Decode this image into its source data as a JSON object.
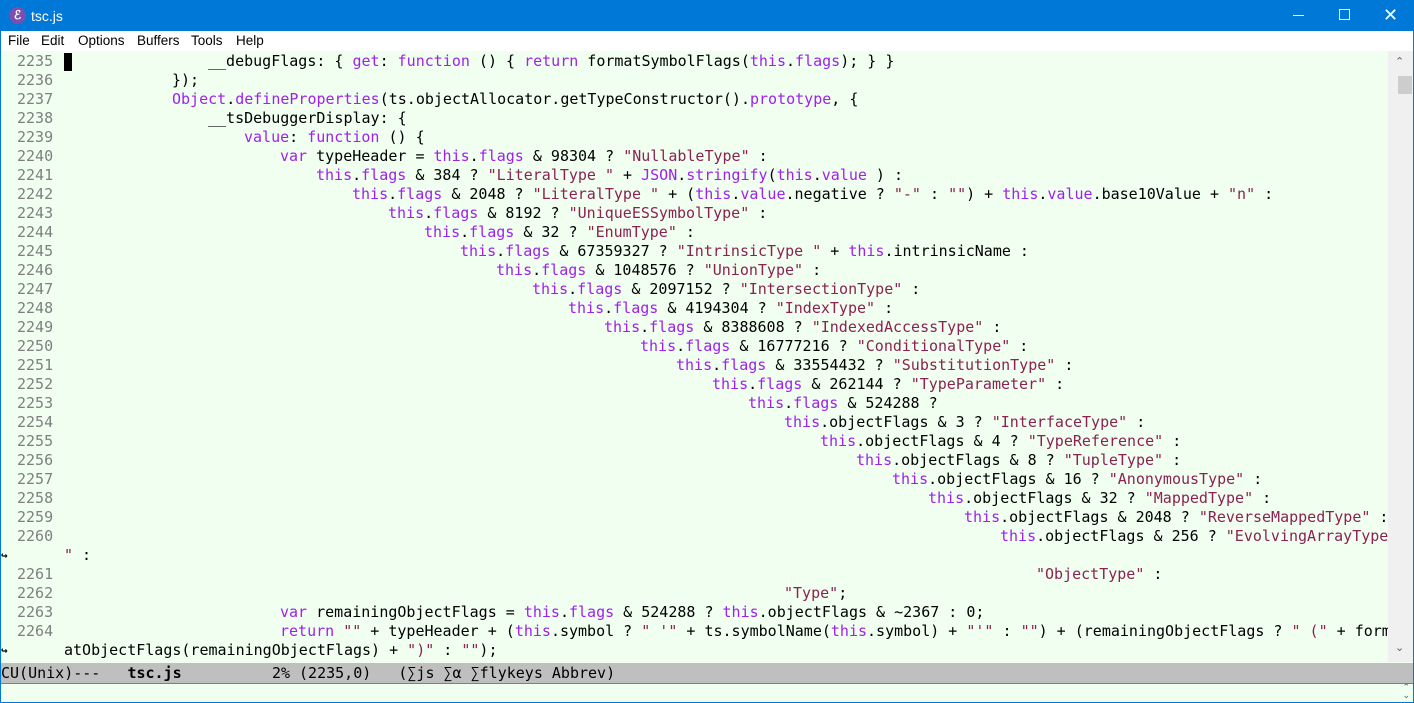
{
  "window": {
    "title": "tsc.js",
    "app_icon": "emacs-icon",
    "controls": [
      "minimize",
      "maximize",
      "close"
    ]
  },
  "menubar": {
    "items": [
      "File",
      "Edit",
      "Options",
      "Buffers",
      "Tools",
      "Help"
    ]
  },
  "editor": {
    "cursor_line": 2235,
    "lines": [
      {
        "num": "2235",
        "indent": 16,
        "tokens": [
          [
            "",
            "__debugFlags: { "
          ],
          [
            "kw",
            "get"
          ],
          [
            "",
            ": "
          ],
          [
            "kw",
            "function"
          ],
          [
            "",
            " () { "
          ],
          [
            "kw",
            "return"
          ],
          [
            "",
            " formatSymbolFlags("
          ],
          [
            "kw",
            "this"
          ],
          [
            "",
            "."
          ],
          [
            "kw",
            "flags"
          ],
          [
            "",
            "); } }"
          ]
        ]
      },
      {
        "num": "2236",
        "indent": 12,
        "tokens": [
          [
            "",
            "});"
          ]
        ]
      },
      {
        "num": "2237",
        "indent": 12,
        "tokens": [
          [
            "kw",
            "Object"
          ],
          [
            "",
            "."
          ],
          [
            "kw",
            "defineProperties"
          ],
          [
            "",
            "(ts.objectAllocator.getTypeConstructor()."
          ],
          [
            "kw",
            "prototype"
          ],
          [
            "",
            ", {"
          ]
        ]
      },
      {
        "num": "2238",
        "indent": 16,
        "tokens": [
          [
            "",
            "__tsDebuggerDisplay: {"
          ]
        ]
      },
      {
        "num": "2239",
        "indent": 20,
        "tokens": [
          [
            "kw",
            "value"
          ],
          [
            "",
            ": "
          ],
          [
            "kw",
            "function"
          ],
          [
            "",
            " () {"
          ]
        ]
      },
      {
        "num": "2240",
        "indent": 24,
        "tokens": [
          [
            "kw",
            "var"
          ],
          [
            "",
            " typeHeader = "
          ],
          [
            "kw",
            "this"
          ],
          [
            "",
            "."
          ],
          [
            "kw",
            "flags"
          ],
          [
            "",
            " & 98304 ? "
          ],
          [
            "str",
            "\"NullableType\""
          ],
          [
            "",
            " :"
          ]
        ]
      },
      {
        "num": "2241",
        "indent": 28,
        "tokens": [
          [
            "kw",
            "this"
          ],
          [
            "",
            "."
          ],
          [
            "kw",
            "flags"
          ],
          [
            "",
            " & 384 ? "
          ],
          [
            "str",
            "\"LiteralType \""
          ],
          [
            "",
            " + "
          ],
          [
            "kw",
            "JSON"
          ],
          [
            "",
            "."
          ],
          [
            "kw",
            "stringify"
          ],
          [
            "",
            "("
          ],
          [
            "kw",
            "this"
          ],
          [
            "",
            "."
          ],
          [
            "kw",
            "value"
          ],
          [
            "",
            " ) :"
          ]
        ]
      },
      {
        "num": "2242",
        "indent": 32,
        "tokens": [
          [
            "kw",
            "this"
          ],
          [
            "",
            "."
          ],
          [
            "kw",
            "flags"
          ],
          [
            "",
            " & 2048 ? "
          ],
          [
            "str",
            "\"LiteralType \""
          ],
          [
            "",
            " + ("
          ],
          [
            "kw",
            "this"
          ],
          [
            "",
            "."
          ],
          [
            "kw",
            "value"
          ],
          [
            "",
            ".negative ? "
          ],
          [
            "str",
            "\"-\""
          ],
          [
            "",
            " : "
          ],
          [
            "str",
            "\"\""
          ],
          [
            "",
            ") + "
          ],
          [
            "kw",
            "this"
          ],
          [
            "",
            "."
          ],
          [
            "kw",
            "value"
          ],
          [
            "",
            ".base10Value + "
          ],
          [
            "str",
            "\"n\""
          ],
          [
            "",
            " :"
          ]
        ]
      },
      {
        "num": "2243",
        "indent": 36,
        "tokens": [
          [
            "kw",
            "this"
          ],
          [
            "",
            "."
          ],
          [
            "kw",
            "flags"
          ],
          [
            "",
            " & 8192 ? "
          ],
          [
            "str",
            "\"UniqueESSymbolType\""
          ],
          [
            "",
            " :"
          ]
        ]
      },
      {
        "num": "2244",
        "indent": 40,
        "tokens": [
          [
            "kw",
            "this"
          ],
          [
            "",
            "."
          ],
          [
            "kw",
            "flags"
          ],
          [
            "",
            " & 32 ? "
          ],
          [
            "str",
            "\"EnumType\""
          ],
          [
            "",
            " :"
          ]
        ]
      },
      {
        "num": "2245",
        "indent": 44,
        "tokens": [
          [
            "kw",
            "this"
          ],
          [
            "",
            "."
          ],
          [
            "kw",
            "flags"
          ],
          [
            "",
            " & 67359327 ? "
          ],
          [
            "str",
            "\"IntrinsicType \""
          ],
          [
            "",
            " + "
          ],
          [
            "kw",
            "this"
          ],
          [
            "",
            ".intrinsicName :"
          ]
        ]
      },
      {
        "num": "2246",
        "indent": 48,
        "tokens": [
          [
            "kw",
            "this"
          ],
          [
            "",
            "."
          ],
          [
            "kw",
            "flags"
          ],
          [
            "",
            " & 1048576 ? "
          ],
          [
            "str",
            "\"UnionType\""
          ],
          [
            "",
            " :"
          ]
        ]
      },
      {
        "num": "2247",
        "indent": 52,
        "tokens": [
          [
            "kw",
            "this"
          ],
          [
            "",
            "."
          ],
          [
            "kw",
            "flags"
          ],
          [
            "",
            " & 2097152 ? "
          ],
          [
            "str",
            "\"IntersectionType\""
          ],
          [
            "",
            " :"
          ]
        ]
      },
      {
        "num": "2248",
        "indent": 56,
        "tokens": [
          [
            "kw",
            "this"
          ],
          [
            "",
            "."
          ],
          [
            "kw",
            "flags"
          ],
          [
            "",
            " & 4194304 ? "
          ],
          [
            "str",
            "\"IndexType\""
          ],
          [
            "",
            " :"
          ]
        ]
      },
      {
        "num": "2249",
        "indent": 60,
        "tokens": [
          [
            "kw",
            "this"
          ],
          [
            "",
            "."
          ],
          [
            "kw",
            "flags"
          ],
          [
            "",
            " & 8388608 ? "
          ],
          [
            "str",
            "\"IndexedAccessType\""
          ],
          [
            "",
            " :"
          ]
        ]
      },
      {
        "num": "2250",
        "indent": 64,
        "tokens": [
          [
            "kw",
            "this"
          ],
          [
            "",
            "."
          ],
          [
            "kw",
            "flags"
          ],
          [
            "",
            " & 16777216 ? "
          ],
          [
            "str",
            "\"ConditionalType\""
          ],
          [
            "",
            " :"
          ]
        ]
      },
      {
        "num": "2251",
        "indent": 68,
        "tokens": [
          [
            "kw",
            "this"
          ],
          [
            "",
            "."
          ],
          [
            "kw",
            "flags"
          ],
          [
            "",
            " & 33554432 ? "
          ],
          [
            "str",
            "\"SubstitutionType\""
          ],
          [
            "",
            " :"
          ]
        ]
      },
      {
        "num": "2252",
        "indent": 72,
        "tokens": [
          [
            "kw",
            "this"
          ],
          [
            "",
            "."
          ],
          [
            "kw",
            "flags"
          ],
          [
            "",
            " & 262144 ? "
          ],
          [
            "str",
            "\"TypeParameter\""
          ],
          [
            "",
            " :"
          ]
        ]
      },
      {
        "num": "2253",
        "indent": 76,
        "tokens": [
          [
            "kw",
            "this"
          ],
          [
            "",
            "."
          ],
          [
            "kw",
            "flags"
          ],
          [
            "",
            " & 524288 ?"
          ]
        ]
      },
      {
        "num": "2254",
        "indent": 80,
        "tokens": [
          [
            "kw",
            "this"
          ],
          [
            "",
            ".objectFlags & 3 ? "
          ],
          [
            "str",
            "\"InterfaceType\""
          ],
          [
            "",
            " :"
          ]
        ]
      },
      {
        "num": "2255",
        "indent": 84,
        "tokens": [
          [
            "kw",
            "this"
          ],
          [
            "",
            ".objectFlags & 4 ? "
          ],
          [
            "str",
            "\"TypeReference\""
          ],
          [
            "",
            " :"
          ]
        ]
      },
      {
        "num": "2256",
        "indent": 88,
        "tokens": [
          [
            "kw",
            "this"
          ],
          [
            "",
            ".objectFlags & 8 ? "
          ],
          [
            "str",
            "\"TupleType\""
          ],
          [
            "",
            " :"
          ]
        ]
      },
      {
        "num": "2257",
        "indent": 92,
        "tokens": [
          [
            "kw",
            "this"
          ],
          [
            "",
            ".objectFlags & 16 ? "
          ],
          [
            "str",
            "\"AnonymousType\""
          ],
          [
            "",
            " :"
          ]
        ]
      },
      {
        "num": "2258",
        "indent": 96,
        "tokens": [
          [
            "kw",
            "this"
          ],
          [
            "",
            ".objectFlags & 32 ? "
          ],
          [
            "str",
            "\"MappedType\""
          ],
          [
            "",
            " :"
          ]
        ]
      },
      {
        "num": "2259",
        "indent": 100,
        "tokens": [
          [
            "kw",
            "this"
          ],
          [
            "",
            ".objectFlags & 2048 ? "
          ],
          [
            "str",
            "\"ReverseMappedType\""
          ],
          [
            "",
            " :"
          ]
        ]
      },
      {
        "num": "2260",
        "indent": 104,
        "wrap": true,
        "tokens": [
          [
            "kw",
            "this"
          ],
          [
            "",
            ".objectFlags & 256 ? "
          ],
          [
            "str",
            "\"EvolvingArrayType"
          ]
        ]
      },
      {
        "num": "",
        "indent": 0,
        "continuation": true,
        "tokens": [
          [
            "str",
            "\""
          ],
          [
            "",
            " :"
          ]
        ]
      },
      {
        "num": "2261",
        "indent": 108,
        "tokens": [
          [
            "str",
            "\"ObjectType\""
          ],
          [
            "",
            " :"
          ]
        ]
      },
      {
        "num": "2262",
        "indent": 80,
        "tokens": [
          [
            "str",
            "\"Type\""
          ],
          [
            ";"
          ]
        ]
      },
      {
        "num": "2263",
        "indent": 24,
        "tokens": [
          [
            "kw",
            "var"
          ],
          [
            "",
            " remainingObjectFlags = "
          ],
          [
            "kw",
            "this"
          ],
          [
            "",
            "."
          ],
          [
            "kw",
            "flags"
          ],
          [
            "",
            " & 524288 ? "
          ],
          [
            "kw",
            "this"
          ],
          [
            "",
            ".objectFlags & ~2367 : 0;"
          ]
        ]
      },
      {
        "num": "2264",
        "indent": 24,
        "wrap": true,
        "tokens": [
          [
            "kw",
            "return"
          ],
          [
            "",
            " "
          ],
          [
            "str",
            "\"\""
          ],
          [
            "",
            " + typeHeader + ("
          ],
          [
            "kw",
            "this"
          ],
          [
            "",
            ".symbol ? "
          ],
          [
            "str",
            "\" '\""
          ],
          [
            "",
            " + ts.symbolName("
          ],
          [
            "kw",
            "this"
          ],
          [
            "",
            ".symbol) + "
          ],
          [
            "str",
            "\"'\""
          ],
          [
            "",
            " : "
          ],
          [
            "str",
            "\"\""
          ],
          [
            "",
            ") + (remainingObjectFlags ? "
          ],
          [
            "str",
            "\" (\""
          ],
          [
            "",
            " + form"
          ]
        ]
      },
      {
        "num": "",
        "indent": 0,
        "continuation": true,
        "tokens": [
          [
            "",
            "atObjectFlags(remainingObjectFlags) + "
          ],
          [
            "str",
            "\")\""
          ],
          [
            "",
            " : "
          ],
          [
            "str",
            "\"\""
          ],
          [
            "",
            ");"
          ]
        ]
      }
    ]
  },
  "modeline": {
    "encoding": "CU(Unix)---",
    "buffer_name": "tsc.js",
    "position": "2% (2235,0)",
    "modes": "(∑js ∑α ∑flykeys Abbrev)"
  },
  "colors": {
    "titlebar": "#0078d7",
    "editor_bg": "#f0fff0",
    "keyword": "#a020f0",
    "string": "#8b2252",
    "line_number": "#7f7f7f",
    "modeline_bg": "#bfbfbf"
  }
}
